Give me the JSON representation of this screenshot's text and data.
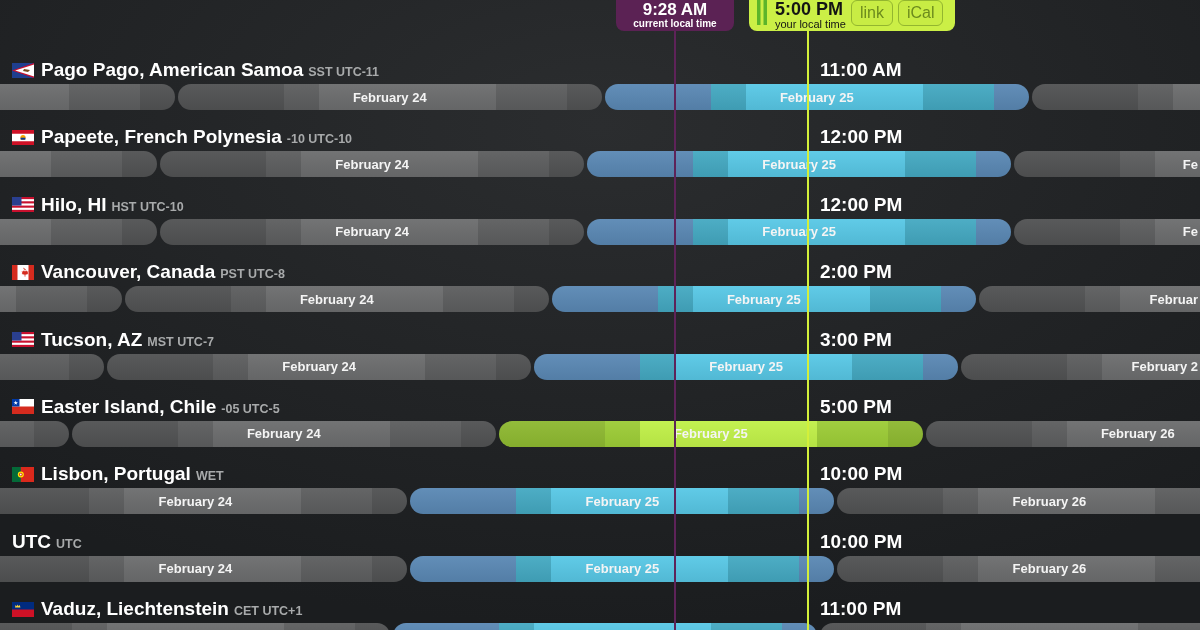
{
  "markers": [
    {
      "kind": "current",
      "time": "9:28 AM",
      "caption": "current local time",
      "level": 0.5625
    },
    {
      "kind": "selected",
      "time": "5:00 PM",
      "caption": "your local time",
      "level": 0.6733,
      "buttons": [
        "link",
        "iCal"
      ]
    }
  ],
  "rows": [
    {
      "city": "Pago Pago, American Samoa",
      "zone": "SST UTC-11",
      "kind": "samoa",
      "time": "11:00 AM",
      "home": false,
      "days": [
        {
          "selected": false
        },
        {
          "label": "February 24",
          "selected": false
        },
        {
          "label": "February 25",
          "selected": true,
          "level": 0.4792
        },
        {
          "selected": false
        }
      ]
    },
    {
      "city": "Papeete, French Polynesia",
      "zone": "-10 UTC-10",
      "kind": "polynesia",
      "time": "12:00 PM",
      "home": false,
      "days": [
        {
          "selected": false
        },
        {
          "label": "February 24",
          "selected": false
        },
        {
          "label": "February 25",
          "selected": true,
          "level": 0.5208
        },
        {
          "label": "Fe",
          "selected": false
        }
      ]
    },
    {
      "city": "Hilo, HI",
      "zone": "HST UTC-10",
      "kind": "usa",
      "time": "12:00 PM",
      "home": false,
      "days": [
        {
          "selected": false
        },
        {
          "label": "February 24",
          "selected": false
        },
        {
          "label": "February 25",
          "selected": true,
          "level": 0.5208
        },
        {
          "label": "Fe",
          "selected": false
        }
      ]
    },
    {
      "city": "Vancouver, Canada",
      "zone": "PST UTC-8",
      "kind": "canada",
      "time": "2:00 PM",
      "home": false,
      "days": [
        {
          "selected": false
        },
        {
          "label": "February 24",
          "selected": false
        },
        {
          "label": "February 25",
          "selected": true,
          "level": 0.6042
        },
        {
          "label": "Februar",
          "selected": false
        }
      ]
    },
    {
      "city": "Tucson, AZ",
      "zone": "MST UTC-7",
      "kind": "usa",
      "time": "3:00 PM",
      "home": false,
      "days": [
        {
          "selected": false
        },
        {
          "label": "February 24",
          "selected": false
        },
        {
          "label": "February 25",
          "selected": true,
          "level": 0.6458
        },
        {
          "label": "February 2",
          "selected": false
        }
      ]
    },
    {
      "city": "Easter Island, Chile",
      "zone": "-05 UTC-5",
      "kind": "chile",
      "time": "5:00 PM",
      "home": true,
      "days": [
        {
          "selected": false
        },
        {
          "label": "February 24",
          "selected": false
        },
        {
          "label": "February 25",
          "selected": true,
          "level": 0.7292
        },
        {
          "label": "February 26",
          "selected": false
        }
      ]
    },
    {
      "city": "Lisbon, Portugal",
      "zone": "WET",
      "kind": "portugal",
      "time": "10:00 PM",
      "home": false,
      "days": [
        {
          "label": "February 24",
          "selected": false
        },
        {
          "label": "February 25",
          "selected": true,
          "level": 0.9375
        },
        {
          "label": "February 26",
          "selected": false
        }
      ]
    },
    {
      "city": "UTC",
      "zone": "UTC",
      "kind": "plain",
      "time": "10:00 PM",
      "home": false,
      "days": [
        {
          "label": "February 24",
          "selected": false
        },
        {
          "label": "February 25",
          "selected": true,
          "level": 0.9375
        },
        {
          "label": "February 26",
          "selected": false
        }
      ]
    },
    {
      "city": "Vaduz, Liechtenstein",
      "zone": "CET UTC+1",
      "kind": "liechtenstein",
      "time": "11:00 PM",
      "home": false,
      "days": [
        {
          "selected": false
        },
        {
          "selected": true,
          "level": 0.9792
        },
        {
          "selected": false
        }
      ]
    }
  ]
}
